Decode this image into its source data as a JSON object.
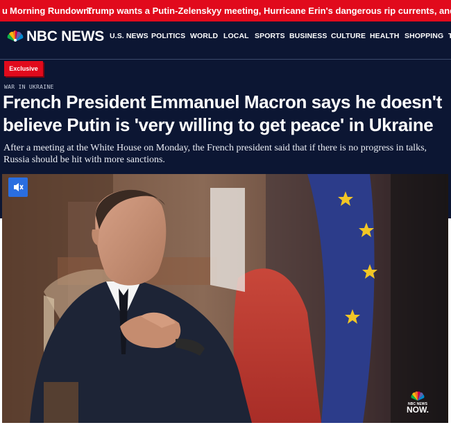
{
  "ticker": {
    "lead": "u",
    "label": "Morning Rundown:",
    "text": "Trump wants a Putin-Zelenskyy meeting, Hurricane Erin's dangerous rip currents, and delays to a promising drug for"
  },
  "header": {
    "logo_text": "NBC NEWS",
    "nav": [
      "U.S. NEWS",
      "POLITICS",
      "WORLD",
      "LOCAL",
      "SPORTS",
      "BUSINESS",
      "CULTURE",
      "HEALTH",
      "SHOPPING",
      "T"
    ]
  },
  "article": {
    "badge": "Exclusive",
    "category": "WAR IN UKRAINE",
    "headline": "French President Emmanuel Macron says he doesn't believe Putin is 'very willing to get peace' in Ukraine",
    "dek": "After a meeting at the White House on Monday, the French president said that if there is no progress in talks, Russia should be hit with more sanctions."
  },
  "video": {
    "mute_icon": "muted-speaker-icon",
    "watermark_small": "NBC NEWS",
    "watermark_big": "NOW."
  },
  "colors": {
    "ticker_bg": "#e10a1c",
    "page_bg": "#0c1633",
    "badge_bg": "#e10a1c",
    "mute_button_bg": "#2a6ee0"
  }
}
